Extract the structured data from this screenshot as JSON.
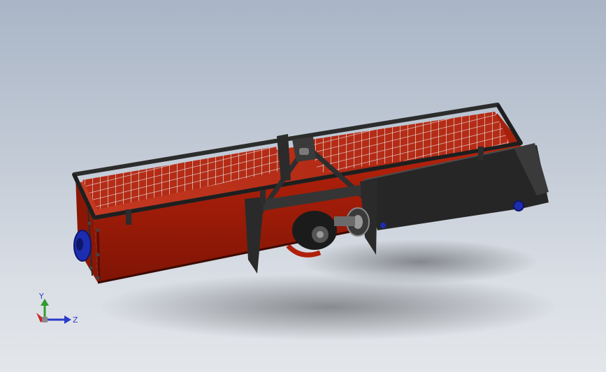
{
  "viewport": {
    "background_top": "#a9b5c6",
    "background_bottom": "#e3e6ea"
  },
  "model": {
    "body_color": "#b0200a",
    "frame_color": "#2c2c2c",
    "grille_color": "#d9d9d9",
    "bearing_color": "#1d2db0",
    "housing_color": "#1e1e1e"
  },
  "triad": {
    "y_label": "Y",
    "z_label": "Z",
    "y_axis_color": "#2f9d2f",
    "z_axis_color": "#2a3bc8",
    "x_axis_color": "#c9252b"
  }
}
